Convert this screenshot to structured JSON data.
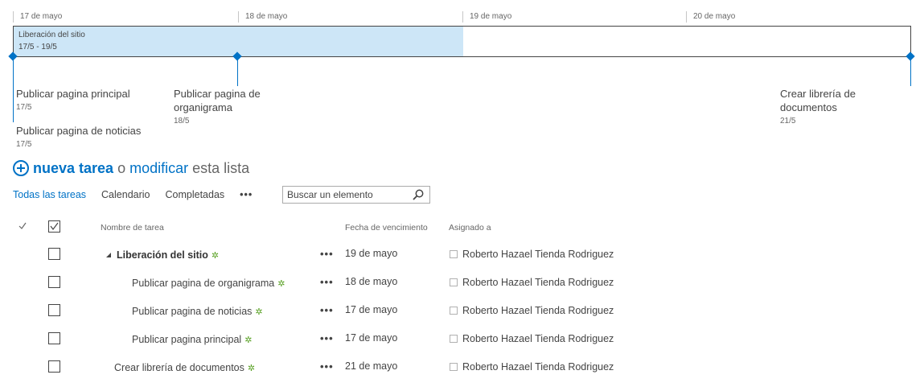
{
  "timeline": {
    "dates": [
      "17 de mayo",
      "18 de mayo",
      "19 de mayo",
      "20 de mayo"
    ],
    "bar": {
      "title": "Liberación del sitio",
      "range": "17/5 - 19/5"
    },
    "milestones": [
      {
        "title": "Publicar pagina principal",
        "date": "17/5"
      },
      {
        "title": "Publicar pagina de noticias",
        "date": "17/5"
      },
      {
        "title_line1": "Publicar pagina de",
        "title_line2": "organigrama",
        "date": "18/5"
      },
      {
        "title_line1": "Crear librería de",
        "title_line2": "documentos",
        "date": "21/5"
      }
    ]
  },
  "heading": {
    "new_task": "nueva tarea",
    "or": "o",
    "edit": "modificar",
    "rest": "esta lista"
  },
  "views": {
    "tabs": [
      "Todas las tareas",
      "Calendario",
      "Completadas"
    ],
    "more": "•••",
    "active_index": 0
  },
  "search": {
    "placeholder": "Buscar un elemento",
    "icon": "search-icon"
  },
  "list": {
    "columns": {
      "name": "Nombre de tarea",
      "due": "Fecha de vencimiento",
      "assigned": "Asignado a"
    },
    "new_marker": "✲",
    "menu": "•••",
    "rows": [
      {
        "name": "Liberación del sitio",
        "due": "19 de mayo",
        "assigned": "Roberto Hazael Tienda Rodriguez",
        "level": "parent"
      },
      {
        "name": "Publicar pagina de organigrama",
        "due": "18 de mayo",
        "assigned": "Roberto Hazael Tienda Rodriguez",
        "level": "child"
      },
      {
        "name": "Publicar pagina de noticias",
        "due": "17 de mayo",
        "assigned": "Roberto Hazael Tienda Rodriguez",
        "level": "child"
      },
      {
        "name": "Publicar pagina principal",
        "due": "17 de mayo",
        "assigned": "Roberto Hazael Tienda Rodriguez",
        "level": "child"
      },
      {
        "name": "Crear librería de documentos",
        "due": "21 de mayo",
        "assigned": "Roberto Hazael Tienda Rodriguez",
        "level": "top"
      }
    ]
  },
  "colors": {
    "accent": "#0072c6",
    "bar": "#cde6f7",
    "new_marker": "#59a124"
  }
}
